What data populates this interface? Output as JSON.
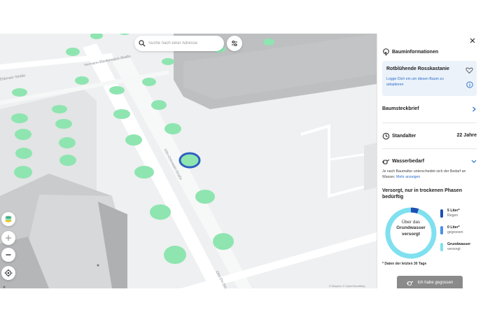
{
  "search": {
    "placeholder": "Suche nach einer Adresse"
  },
  "map": {
    "streets": [
      "Hermann-Blankenstein-Straße",
      "Otto-Ostrowski-Straße",
      "Otto-Dix-Straße",
      "Eldenaer Straße"
    ],
    "colors": {
      "tree": "#8ee5b0",
      "selected_ring": "#2e5fc1",
      "building_dark": "#bdbfc1",
      "building_light": "#d3d5d6",
      "ground": "#eef0f1"
    },
    "attribution": "© Mapbox © OpenStreetMap"
  },
  "sidebar": {
    "header": {
      "title": "Bauminformationen",
      "icon": "tree-icon",
      "close_icon": "close-icon"
    },
    "tree": {
      "name": "Rotblühende Rosskastanie",
      "login_hint": "Logge Dich ein um diesen Baum zu adoptieren",
      "heart_icon": "heart-icon",
      "info_icon": "info-icon"
    },
    "profile": {
      "label": "Baumsteckbrief",
      "icon": "chevron-right-icon"
    },
    "age": {
      "label": "Standalter",
      "value": "22 Jahre",
      "icon": "clock-icon"
    },
    "water": {
      "label": "Wasserbedarf",
      "icon": "watering-can-icon",
      "chevron_icon": "chevron-up-icon",
      "description": "Je nach Baumalter unterscheidet sich der Bedarf an Wasser.",
      "more_link": "Mehr anzeigen",
      "status": "Versorgt, nur in trockenen Phasen bedürftig",
      "donut": {
        "line1": "Über das",
        "line2": "Grundwasser",
        "line3": "versorgt"
      },
      "legend": [
        {
          "value": "5 Liter*",
          "label": "Regen",
          "color": "#1f4fb5"
        },
        {
          "value": "0 Liter*",
          "label": "gegossen",
          "color": "#4c8fe6"
        },
        {
          "value": "Grundwasser",
          "label": "versorgt",
          "color": "#7fe0f0"
        }
      ],
      "chart_data": {
        "type": "pie",
        "categories": [
          "Regen",
          "gegossen",
          "Grundwasser"
        ],
        "values": [
          5,
          0,
          95
        ]
      },
      "footnote": "* Daten der letzten 30 Tage",
      "button_label": "Ich habe gegossen"
    }
  }
}
